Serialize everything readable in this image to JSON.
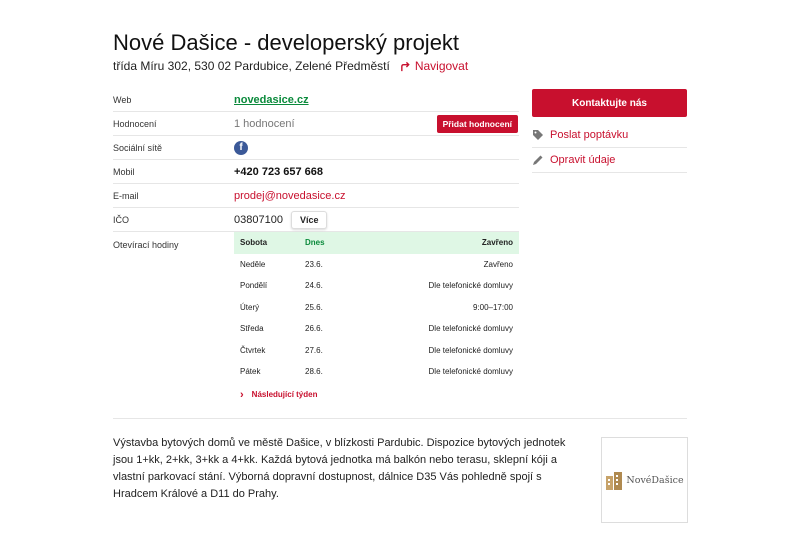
{
  "title": "Nové Dašice - developerský projekt",
  "address": "třída Míru 302, 530 02 Pardubice, Zelené Předměstí",
  "navigate_label": "Navigovat",
  "info": {
    "web_label": "Web",
    "web_value": "novedasice.cz",
    "rating_label": "Hodnocení",
    "rating_value": "1 hodnocení",
    "add_rating_label": "Přidat hodnocení",
    "social_label": "Sociální sítě",
    "mobile_label": "Mobil",
    "mobile_value": "+420 723 657 668",
    "email_label": "E-mail",
    "email_value": "prodej@novedasice.cz",
    "ico_label": "IČO",
    "ico_value": "03807100",
    "more_label": "Více",
    "hours_label": "Otevírací hodiny"
  },
  "hours": [
    {
      "day": "Sobota",
      "date": "Dnes",
      "status": "Zavřeno"
    },
    {
      "day": "Neděle",
      "date": "23.6.",
      "status": "Zavřeno"
    },
    {
      "day": "Pondělí",
      "date": "24.6.",
      "status": "Dle telefonické domluvy"
    },
    {
      "day": "Úterý",
      "date": "25.6.",
      "status": "9:00–17:00"
    },
    {
      "day": "Středa",
      "date": "26.6.",
      "status": "Dle telefonické domluvy"
    },
    {
      "day": "Čtvrtek",
      "date": "27.6.",
      "status": "Dle telefonické domluvy"
    },
    {
      "day": "Pátek",
      "date": "28.6.",
      "status": "Dle telefonické domluvy"
    }
  ],
  "next_week_label": "Následující týden",
  "side": {
    "contact_label": "Kontaktujte nás",
    "inquiry_label": "Poslat poptávku",
    "edit_label": "Opravit údaje"
  },
  "description": "Výstavba bytových domů ve městě Dašice, v blízkosti Pardubic. Dispozice bytových jednotek jsou 1+kk, 2+kk, 3+kk a 4+kk. Každá bytová jednotka má balkón nebo terasu, sklepní kóji a vlastní parkovací stání. Výborná dopravní dostupnost, dálnice D35 Vás pohledně spojí s Hradcem Králové a D11 do Prahy.",
  "logo_text": "NovéDašice",
  "colors": {
    "accent": "#c8102e",
    "link_green": "#0a8a3b",
    "today_bg": "#dff7e5"
  }
}
